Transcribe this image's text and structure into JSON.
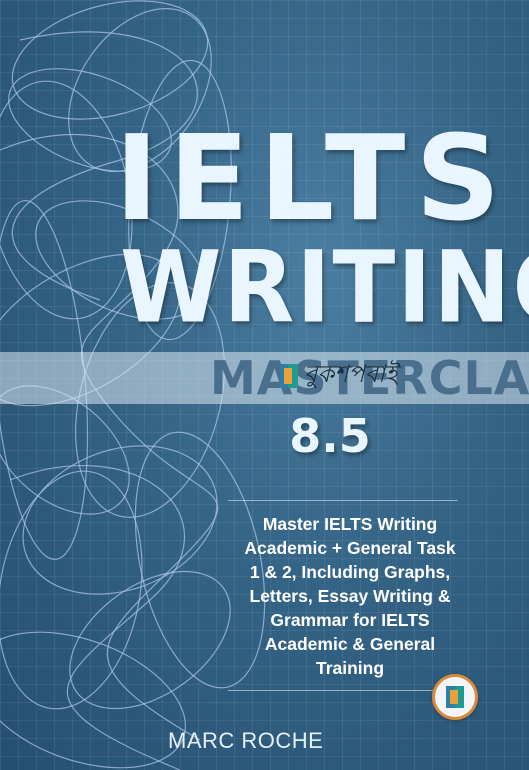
{
  "cover": {
    "title_line1": "IELTS",
    "title_line2": "WRITING",
    "title_line3": "MASTERCLASS",
    "score": "8.5",
    "subtitle_lines": [
      "Master IELTS Writing",
      "Academic + General Task",
      "1 & 2, Including Graphs,",
      "Letters, Essay Writing &",
      "Grammar for IELTS",
      "Academic & General",
      "Training"
    ],
    "author": "MARC ROCHE"
  },
  "watermark": {
    "text": "বুকশপবাই",
    "logo_icon": "book-icon"
  },
  "badge": {
    "icon": "book-icon"
  },
  "colors": {
    "background": "#336385",
    "title": "#e9f6ff",
    "band": "#dce8f0",
    "badge_ring": "#d98a3a"
  }
}
